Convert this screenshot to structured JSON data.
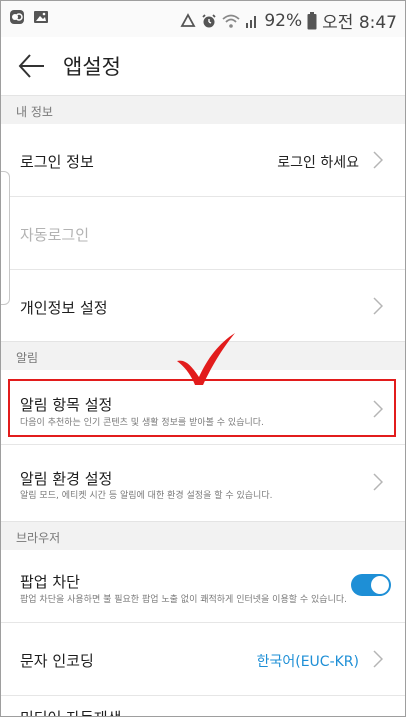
{
  "status_bar": {
    "battery_percent": "92%",
    "time": "오전 8:47",
    "icons": [
      "app-notification-icon",
      "image-notification-icon",
      "recycle-icon",
      "alarm-icon",
      "wifi-icon",
      "signal-icon",
      "battery-icon"
    ]
  },
  "header": {
    "title": "앱설정",
    "back_icon": "arrow-left-icon"
  },
  "sections": {
    "my_info": {
      "header": "내 정보",
      "login_info": {
        "label": "로그인 정보",
        "value": "로그인 하세요"
      },
      "auto_login": {
        "label": "자동로그인"
      },
      "privacy": {
        "label": "개인정보 설정"
      }
    },
    "alerts": {
      "header": "알림",
      "alert_items": {
        "label": "알림 항목 설정",
        "sub": "다음이 추천하는 인기 콘텐츠 및 생활 정보를 받아볼 수 있습니다."
      },
      "alert_env": {
        "label": "알림 환경 설정",
        "sub": "알림 모드, 에티켓 시간 등 알림에 대한 환경 설정을 할 수 있습니다."
      }
    },
    "browser": {
      "header": "브라우저",
      "popup_block": {
        "label": "팝업 차단",
        "sub": "팝업 차단을 사용하면 불 필요한 팝업 노출 없이 쾌적하게 인터넷을 이용할 수 있습니다.",
        "enabled": true
      },
      "encoding": {
        "label": "문자 인코딩",
        "value": "한국어(EUC-KR)"
      },
      "next_label": "미디어 자동재생"
    }
  },
  "colors": {
    "accent": "#1e8fd6",
    "highlight": "#e21c1c"
  }
}
